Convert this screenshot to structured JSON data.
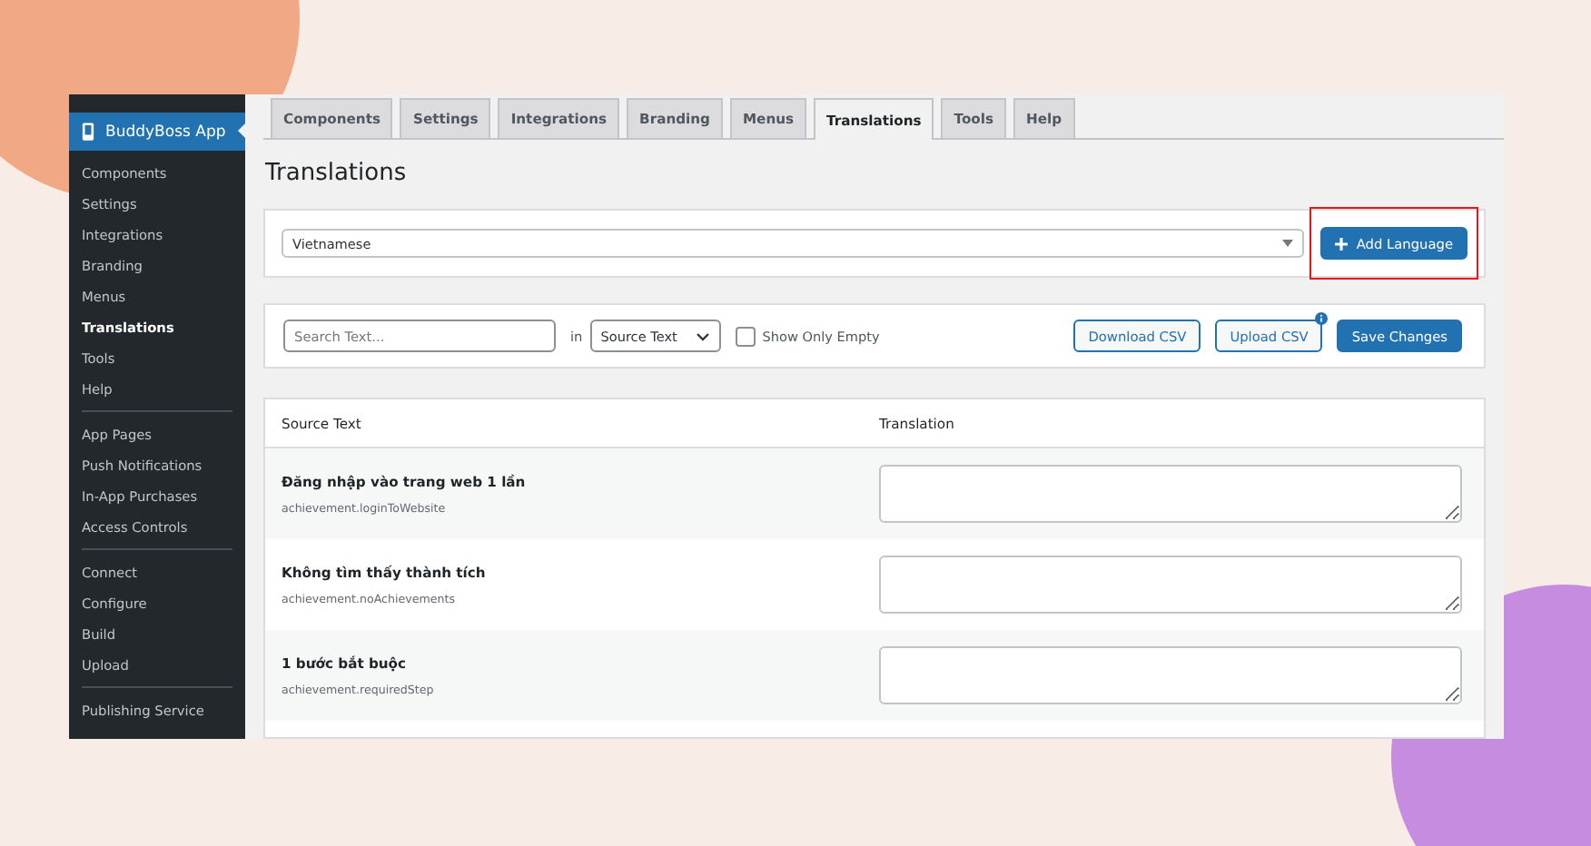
{
  "sidebar": {
    "app_title": "BuddyBoss App",
    "groups": [
      [
        {
          "label": "Components",
          "selected": false
        },
        {
          "label": "Settings",
          "selected": false
        },
        {
          "label": "Integrations",
          "selected": false
        },
        {
          "label": "Branding",
          "selected": false
        },
        {
          "label": "Menus",
          "selected": false
        },
        {
          "label": "Translations",
          "selected": true
        },
        {
          "label": "Tools",
          "selected": false
        },
        {
          "label": "Help",
          "selected": false
        }
      ],
      [
        {
          "label": "App Pages",
          "selected": false
        },
        {
          "label": "Push Notifications",
          "selected": false
        },
        {
          "label": "In-App Purchases",
          "selected": false
        },
        {
          "label": "Access Controls",
          "selected": false
        }
      ],
      [
        {
          "label": "Connect",
          "selected": false
        },
        {
          "label": "Configure",
          "selected": false
        },
        {
          "label": "Build",
          "selected": false
        },
        {
          "label": "Upload",
          "selected": false
        }
      ],
      [
        {
          "label": "Publishing Service",
          "selected": false
        }
      ]
    ]
  },
  "tabs": [
    {
      "label": "Components",
      "selected": false
    },
    {
      "label": "Settings",
      "selected": false
    },
    {
      "label": "Integrations",
      "selected": false
    },
    {
      "label": "Branding",
      "selected": false
    },
    {
      "label": "Menus",
      "selected": false
    },
    {
      "label": "Translations",
      "selected": true
    },
    {
      "label": "Tools",
      "selected": false
    },
    {
      "label": "Help",
      "selected": false
    }
  ],
  "page_title": "Translations",
  "language": {
    "value": "Vietnamese",
    "add_button": "Add Language",
    "highlighted": true
  },
  "filters": {
    "search_placeholder": "Search Text...",
    "in_label": "in",
    "field_value": "Source Text",
    "show_only_empty": {
      "label": "Show Only Empty",
      "checked": false
    },
    "download": "Download CSV",
    "upload": "Upload CSV",
    "save": "Save Changes"
  },
  "table": {
    "columns": [
      "Source Text",
      "Translation"
    ],
    "rows": [
      {
        "source": "Đăng nhập vào trang web 1 lần",
        "key": "achievement.loginToWebsite"
      },
      {
        "source": "Không tìm thấy thành tích",
        "key": "achievement.noAchievements"
      },
      {
        "source": "1 bước bắt buộc",
        "key": "achievement.requiredStep"
      }
    ]
  }
}
